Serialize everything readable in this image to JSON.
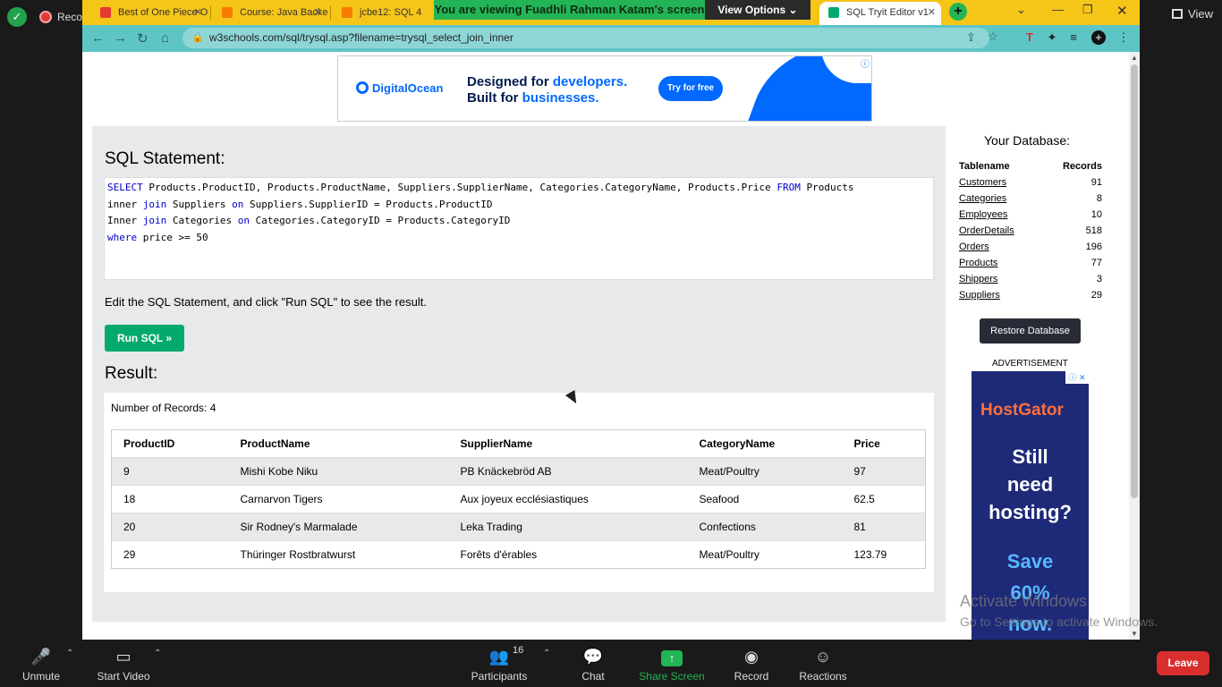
{
  "zoom": {
    "recording_label": "Recording",
    "view_label": "View",
    "share_banner": "You are viewing Fuadhli Rahman Katam's screen",
    "view_options": "View Options",
    "toolbar": {
      "unmute": "Unmute",
      "start_video": "Start Video",
      "participants": "Participants",
      "participants_count": "16",
      "chat": "Chat",
      "share_screen": "Share Screen",
      "record": "Record",
      "reactions": "Reactions",
      "leave": "Leave"
    }
  },
  "browser": {
    "tabs": [
      {
        "label": "Best of One Piece O",
        "color": "#e53935"
      },
      {
        "label": "Course: Java Backe",
        "color": "#f57c00"
      },
      {
        "label": "jcbe12: SQL 4",
        "color": "#f57c00"
      },
      {
        "label": "SQL Tryit Editor v1",
        "color": "#04aa6d"
      }
    ],
    "url": "w3schools.com/sql/trysql.asp?filename=trysql_select_join_inner"
  },
  "ad_top": {
    "brand": "DigitalOcean",
    "line1_a": "Designed for ",
    "line1_b": "developers.",
    "line2_a": "Built for ",
    "line2_b": "businesses.",
    "cta": "Try for free"
  },
  "editor": {
    "sql_heading": "SQL Statement:",
    "sql_lines": [
      [
        {
          "kw": "SELECT"
        },
        {
          "t": " Products.ProductID, Products.ProductName, Suppliers.SupplierName, Categories.CategoryName, Products.Price "
        },
        {
          "kw": "FROM"
        },
        {
          "t": " Products"
        }
      ],
      [
        {
          "t": "inner "
        },
        {
          "kw": "join"
        },
        {
          "t": " Suppliers "
        },
        {
          "kw": "on"
        },
        {
          "t": " Suppliers.SupplierID = Products.ProductID"
        }
      ],
      [
        {
          "t": "Inner "
        },
        {
          "kw": "join"
        },
        {
          "t": " Categories "
        },
        {
          "kw": "on"
        },
        {
          "t": " Categories.CategoryID = Products.CategoryID"
        }
      ],
      [
        {
          "kw": "where"
        },
        {
          "t": " price >= 50"
        }
      ]
    ],
    "hint": "Edit the SQL Statement, and click \"Run SQL\" to see the result.",
    "run_label": "Run SQL »",
    "result_heading": "Result:",
    "record_count": "Number of Records: 4",
    "columns": [
      "ProductID",
      "ProductName",
      "SupplierName",
      "CategoryName",
      "Price"
    ],
    "rows": [
      [
        "9",
        "Mishi Kobe Niku",
        "PB Knäckebröd AB",
        "Meat/Poultry",
        "97"
      ],
      [
        "18",
        "Carnarvon Tigers",
        "Aux joyeux ecclésiastiques",
        "Seafood",
        "62.5"
      ],
      [
        "20",
        "Sir Rodney's Marmalade",
        "Leka Trading",
        "Confections",
        "81"
      ],
      [
        "29",
        "Thüringer Rostbratwurst",
        "Forêts d'érables",
        "Meat/Poultry",
        "123.79"
      ]
    ]
  },
  "sidebar": {
    "title": "Your Database:",
    "col_table": "Tablename",
    "col_records": "Records",
    "tables": [
      {
        "name": "Customers",
        "records": "91"
      },
      {
        "name": "Categories",
        "records": "8"
      },
      {
        "name": "Employees",
        "records": "10"
      },
      {
        "name": "OrderDetails",
        "records": "518"
      },
      {
        "name": "Orders",
        "records": "196"
      },
      {
        "name": "Products",
        "records": "77"
      },
      {
        "name": "Shippers",
        "records": "3"
      },
      {
        "name": "Suppliers",
        "records": "29"
      }
    ],
    "restore_label": "Restore Database",
    "ad_label": "ADVERTISEMENT",
    "ad": {
      "brand": "HostGator",
      "line1": "Still",
      "line2": "need",
      "line3": "hosting?",
      "save1": "Save",
      "save2": "60%",
      "save3": "now."
    }
  },
  "watermark": {
    "line1": "Activate Windows",
    "line2": "Go to Settings to activate Windows."
  }
}
